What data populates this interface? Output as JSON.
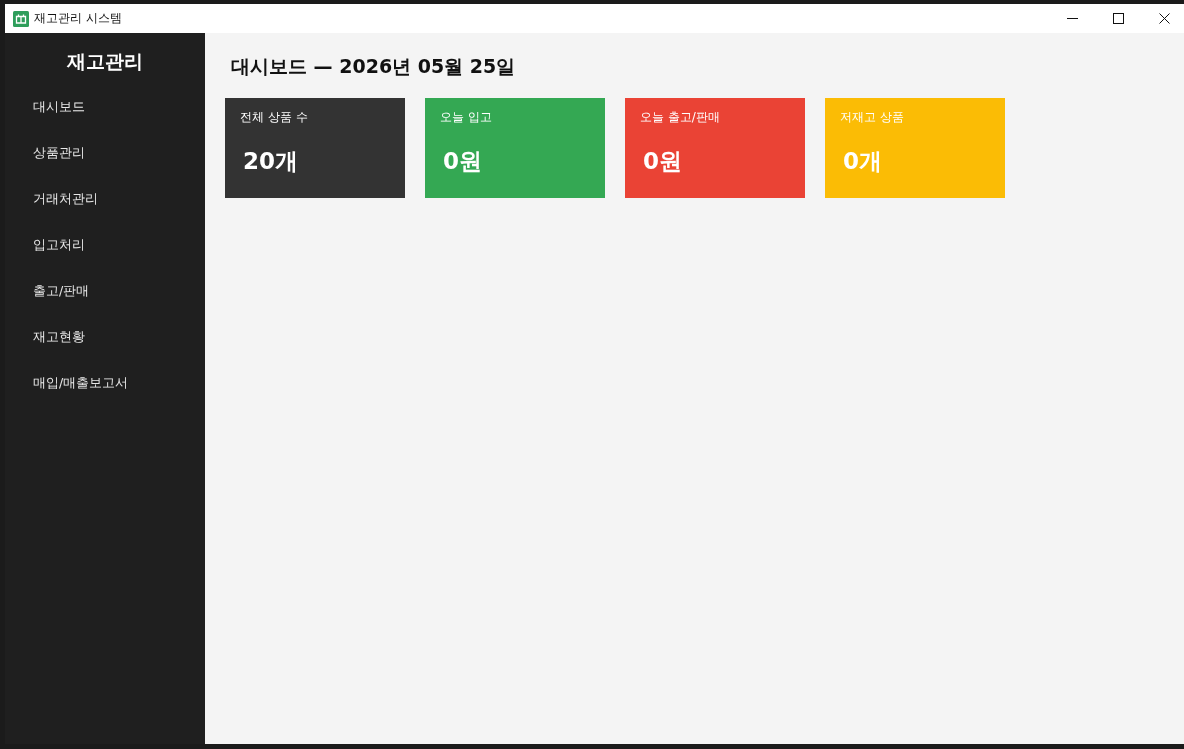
{
  "window": {
    "title": "재고관리 시스템"
  },
  "sidebar": {
    "title": "재고관리",
    "items": [
      {
        "label": "대시보드"
      },
      {
        "label": "상품관리"
      },
      {
        "label": "거래처관리"
      },
      {
        "label": "입고처리"
      },
      {
        "label": "출고/판매"
      },
      {
        "label": "재고현황"
      },
      {
        "label": "매입/매출보고서"
      }
    ]
  },
  "main": {
    "heading": "대시보드 — 2026년 05월 25일",
    "cards": [
      {
        "label": "전체 상품 수",
        "value": "20개",
        "color": "#333333"
      },
      {
        "label": "오늘 입고",
        "value": "0원",
        "color": "#34a853"
      },
      {
        "label": "오늘 출고/판매",
        "value": "0원",
        "color": "#ea4335"
      },
      {
        "label": "저재고 상품",
        "value": "0개",
        "color": "#fbbc05"
      }
    ]
  }
}
